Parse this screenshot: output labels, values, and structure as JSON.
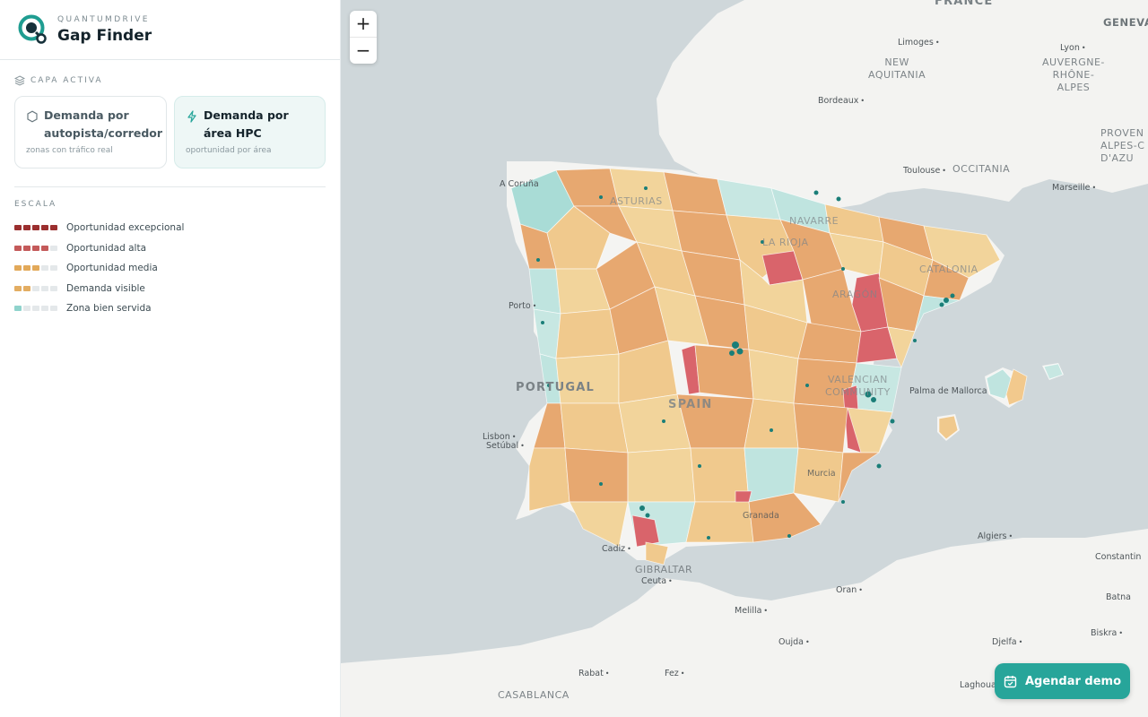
{
  "brand": {
    "kicker": "QUANTUMDRIVE",
    "title": "Gap Finder"
  },
  "layer_section": {
    "label": "CAPA ACTIVA",
    "options": [
      {
        "title": "Demanda por autopista/corredor",
        "subtitle": "zonas con tráfico real",
        "active": false,
        "icon": "hexagon-icon"
      },
      {
        "title": "Demanda por área HPC",
        "subtitle": "oportunidad por área",
        "active": true,
        "icon": "bolt-icon"
      }
    ]
  },
  "scale": {
    "label": "ESCALA",
    "items": [
      {
        "label": "Oportunidad excepcional",
        "level": 5,
        "color": "#9b2f2f"
      },
      {
        "label": "Oportunidad alta",
        "level": 4,
        "color": "#c45a5a"
      },
      {
        "label": "Oportunidad media",
        "level": 3,
        "color": "#e2a95a"
      },
      {
        "label": "Demanda visible",
        "level": 2,
        "color": "#e3ad62"
      },
      {
        "label": "Zona bien servida",
        "level": 1,
        "color": "#8fd3cc"
      }
    ]
  },
  "map": {
    "zoom_in": "+",
    "zoom_out": "−",
    "labels": {
      "france": "FRANCE",
      "geneva": "GENEVA",
      "limoges": "Limoges",
      "lyon": "Lyon",
      "nouvelle": "NEW\nAQUITANIA",
      "auvergne": "AUVERGNE-\nRHÔNE-\nALPES",
      "bordeaux": "Bordeaux",
      "provence": "PROVEN\nALPES-C\nD'AZU",
      "toulouse": "Toulouse",
      "occitania": "OCCITANIA",
      "marseille": "Marseille",
      "acoruna": "A Coruña",
      "asturias": "ASTURIAS",
      "navarre": "NAVARRE",
      "larioja": "LA RIOJA",
      "catalonia": "CATALONIA",
      "aragon": "ARAGÓN",
      "porto": "Porto",
      "portugal": "PORTUGAL",
      "spain": "SPAIN",
      "lisbon": "Lisbon",
      "setubal": "Setúbal",
      "palma": "Palma de Mallorca",
      "valencia": "VALENCIAN\nCOMMUNITY",
      "murcia": "Murcia",
      "granada": "Granada",
      "cadiz": "Cadiz",
      "gibraltar": "GIBRALTAR",
      "ceuta": "Ceuta",
      "algiers": "Algiers",
      "oran": "Oran",
      "melilla": "Melilla",
      "oujda": "Oujda",
      "constantine": "Constantin",
      "batna": "Batna",
      "djelfa": "Djelfa",
      "biskra": "Biskra",
      "rabat": "Rabat",
      "fez": "Fez",
      "casablanca": "CASABLANCA",
      "laghouat": "Laghouat"
    }
  },
  "cta": {
    "label": "Agendar demo",
    "icon": "calendar-icon"
  },
  "colors": {
    "accent": "#27a59a",
    "sea": "#cfd7da",
    "land": "#f4f4f2"
  }
}
